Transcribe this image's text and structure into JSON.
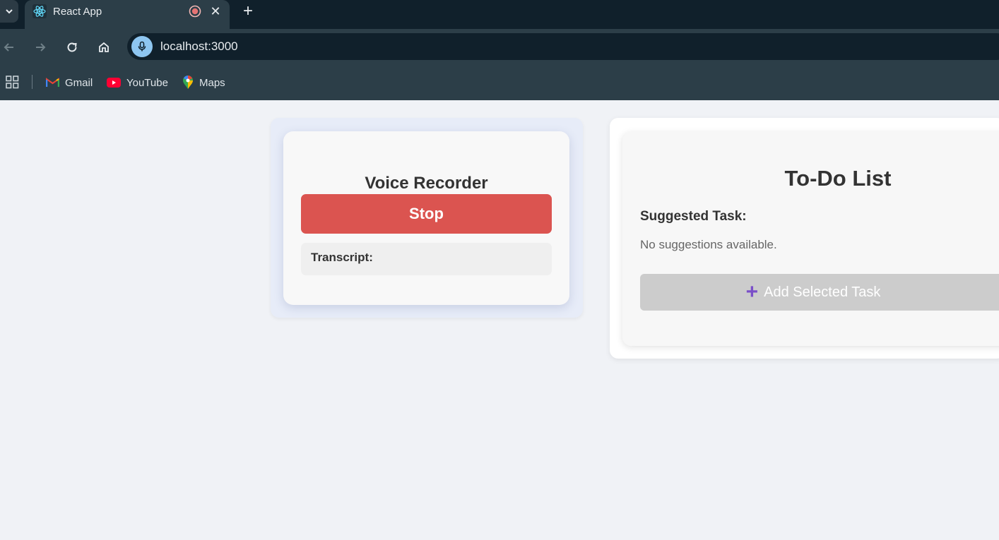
{
  "browser": {
    "tab": {
      "title": "React App",
      "close_glyph": "✕"
    },
    "new_tab_glyph": "+",
    "url": "localhost:3000",
    "bookmarks": [
      {
        "label": "Gmail",
        "icon": "gmail-icon"
      },
      {
        "label": "YouTube",
        "icon": "youtube-icon"
      },
      {
        "label": "Maps",
        "icon": "maps-icon"
      }
    ]
  },
  "voice_recorder": {
    "title": "Voice Recorder",
    "stop_label": "Stop",
    "transcript_label": "Transcript:"
  },
  "todo": {
    "title": "To-Do List",
    "suggested_label": "Suggested Task:",
    "empty_message": "No suggestions available.",
    "add_button_label": "Add Selected Task",
    "add_icon_glyph": "+"
  },
  "colors": {
    "stop_button": "#db5450",
    "add_button_disabled": "#cccccc",
    "plus_icon": "#7a4fc8",
    "page_background": "#f0f2f6"
  }
}
